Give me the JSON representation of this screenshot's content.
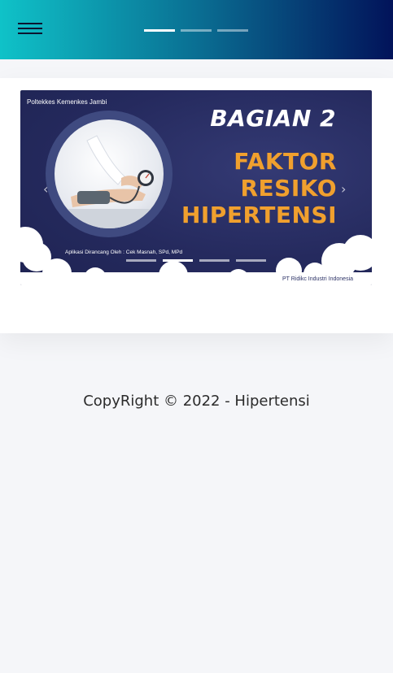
{
  "header": {
    "menu_icon": "hamburger-menu-icon",
    "slider_indicators": {
      "count": 3,
      "active_index": 0
    },
    "colors": {
      "gradient_start": "#0fc2c8",
      "gradient_mid": "#0a6f93",
      "gradient_end": "#02135a"
    }
  },
  "banner": {
    "org": "Poltekkes Kemenkes Jambi",
    "subtitle": "BAGIAN 2",
    "title_lines": [
      "FAKTOR",
      "RESIKO",
      "HIPERTENSI"
    ],
    "credit": "Aplikasi Dirancang Oleh : Cek Masnah, SPd, MPd",
    "company": "PT Ridikc Industri Indonesia",
    "image_icon": "blood-pressure-check-image",
    "prev_icon": "chevron-left-icon",
    "next_icon": "chevron-right-icon",
    "indicators": {
      "count": 4,
      "active_index": 1
    },
    "colors": {
      "background": "#252a5e",
      "title": "#f0a02e",
      "subtitle": "#ffffff"
    }
  },
  "footer": {
    "copyright": "CopyRight © 2022 - Hipertensi"
  }
}
